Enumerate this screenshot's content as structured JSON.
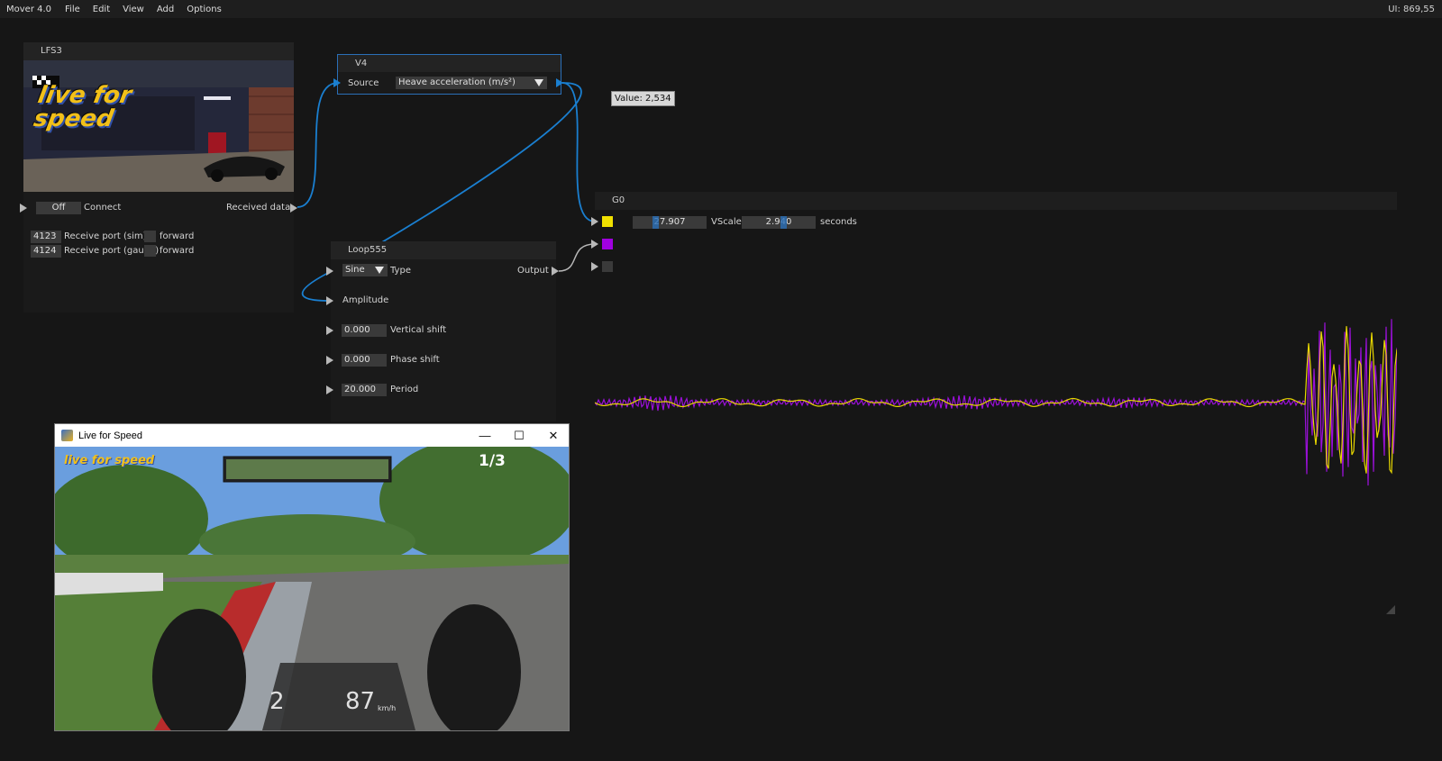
{
  "menubar": {
    "app_title": "Mover 4.0",
    "items": [
      "File",
      "Edit",
      "View",
      "Add",
      "Options"
    ],
    "ui_coords": "UI: 869,55"
  },
  "lfs3": {
    "title": "LFS3",
    "logo_text": "live for speed",
    "connect_toggle": "Off",
    "connect_label": "Connect",
    "received_label": "Received data",
    "port_sim_value": "4123",
    "port_sim_label": "Receive port (sim)",
    "port_gauge_value": "4124",
    "port_gauge_label": "Receive port (gauge)",
    "forward_label": "forward"
  },
  "v4": {
    "title": "V4",
    "source_label": "Source",
    "source_value": "Heave acceleration (m/s²)"
  },
  "tooltip": {
    "text": "Value: 2,534"
  },
  "loop": {
    "title": "Loop555",
    "type_value": "Sine",
    "type_label": "Type",
    "output_label": "Output",
    "amplitude_label": "Amplitude",
    "vshift_value": "0.000",
    "vshift_label": "Vertical shift",
    "pshift_value": "0.000",
    "pshift_label": "Phase shift",
    "period_value": "20.000",
    "period_label": "Period"
  },
  "graph": {
    "title": "G0",
    "vscale_value": "27.907",
    "vscale_label": "VScale",
    "seconds_value": "2.940",
    "seconds_label": "seconds",
    "colors": {
      "series1": "#f0e000",
      "series2": "#a000e0",
      "series3": "#3a3a3a"
    }
  },
  "game_window": {
    "title": "Live for Speed",
    "minimize": "—",
    "maximize": "☐",
    "close": "✕",
    "lap": "1/3",
    "gear": "2",
    "speed": "87",
    "speed_unit": "km/h"
  },
  "colors": {
    "wire": "#1a7fd0",
    "selection": "#2a6fb8"
  }
}
